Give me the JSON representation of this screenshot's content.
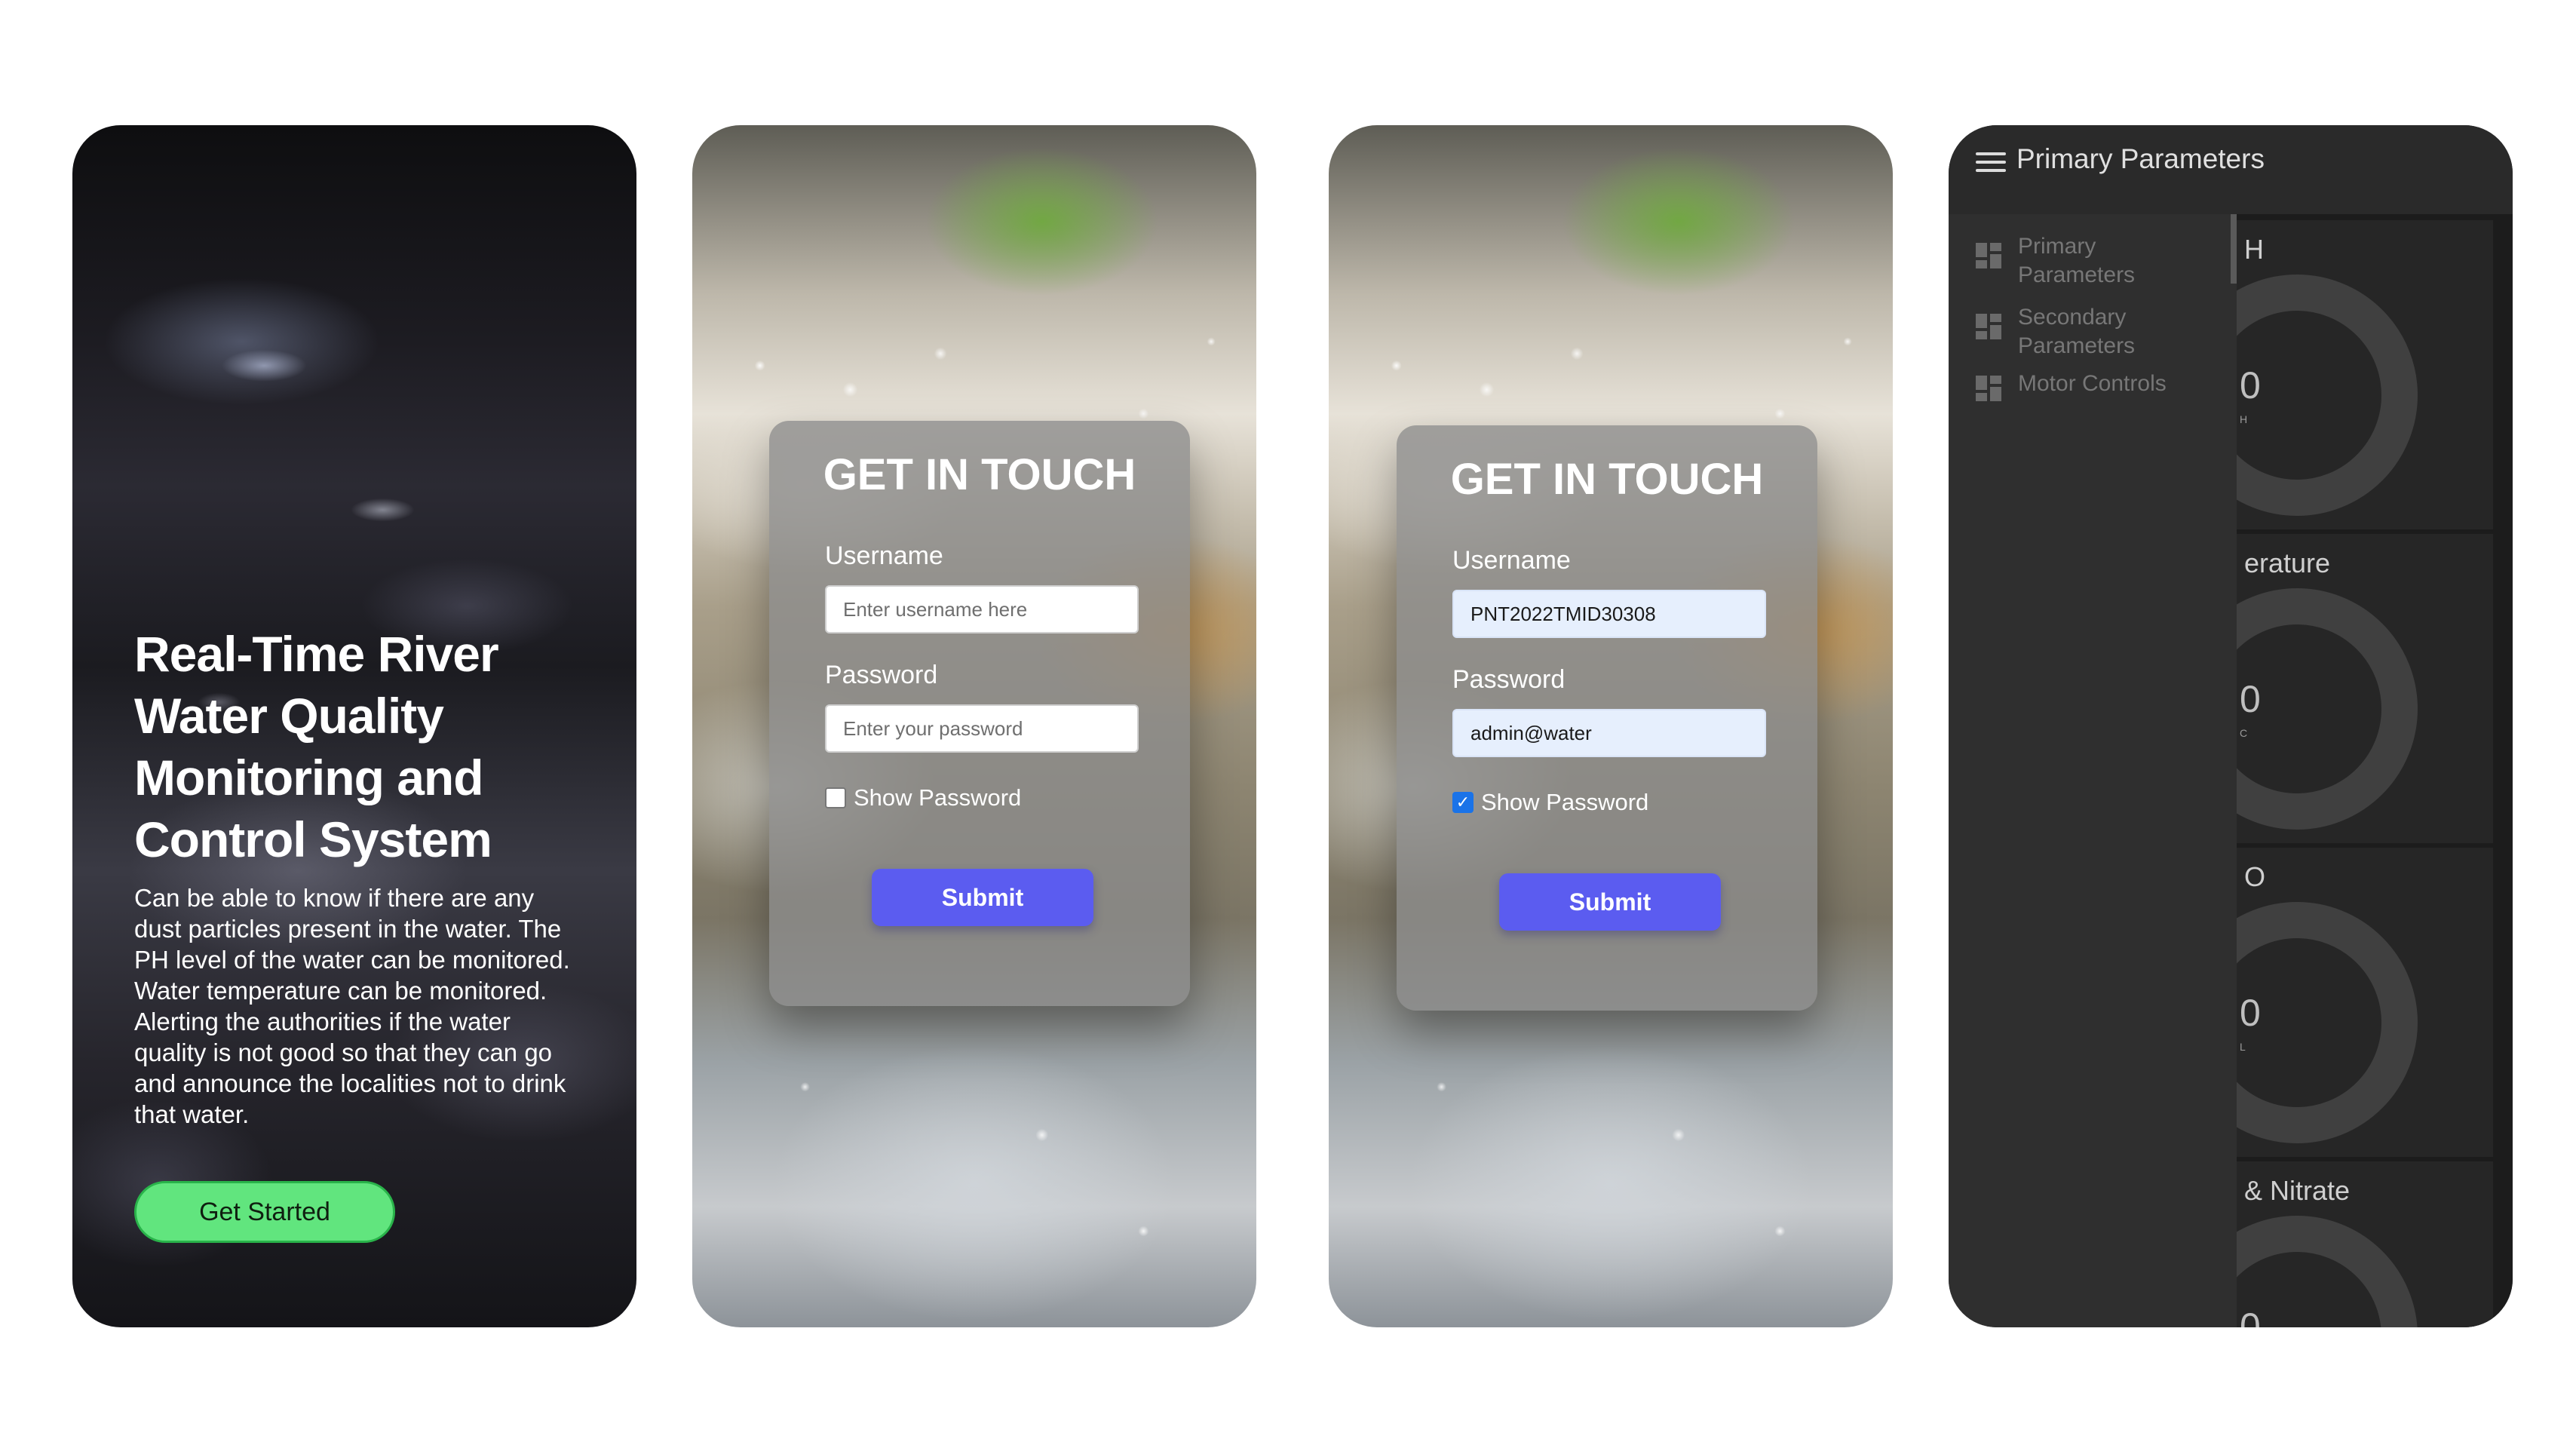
{
  "screen1": {
    "title": "Real-Time River Water Quality Monitoring and Control System",
    "description": "Can be able to know if there are any dust particles present in the water. The PH level of the water can be monitored. Water temperature can be monitored. Alerting the authorities if the water quality is not good so that they can go and announce the localities not to drink that water.",
    "cta_label": "Get Started"
  },
  "screen2": {
    "card_title": "GET IN TOUCH",
    "username_label": "Username",
    "username_placeholder": "Enter username here",
    "password_label": "Password",
    "password_placeholder": "Enter your password",
    "show_password_label": "Show Password",
    "show_password_checked": false,
    "submit_label": "Submit"
  },
  "screen3": {
    "card_title": "GET IN TOUCH",
    "username_label": "Username",
    "username_value": "PNT2022TMID30308",
    "password_label": "Password",
    "password_value": "admin@water",
    "show_password_label": "Show Password",
    "show_password_checked": true,
    "submit_label": "Submit"
  },
  "screen4": {
    "app_title": "Primary Parameters",
    "drawer_items": [
      {
        "label": "Primary Parameters",
        "icon": "dashboard-icon"
      },
      {
        "label": "Secondary Parameters",
        "icon": "dashboard-icon"
      },
      {
        "label": "Motor Controls",
        "icon": "dashboard-icon"
      }
    ],
    "gauges": [
      {
        "label_visible": "H",
        "value_visible": "0",
        "unit_visible": "H"
      },
      {
        "label_visible": "erature",
        "value_visible": "0",
        "unit_visible": "C"
      },
      {
        "label_visible": "O",
        "value_visible": "0",
        "unit_visible": "L"
      },
      {
        "label_visible": "& Nitrate",
        "value_visible": "0",
        "unit_visible": ""
      }
    ]
  },
  "colors": {
    "cta_green": "#61e57e",
    "submit_purple": "#5b5cf0",
    "dashboard_bg": "#1c1c1c",
    "drawer_bg": "#2f2f2f"
  }
}
